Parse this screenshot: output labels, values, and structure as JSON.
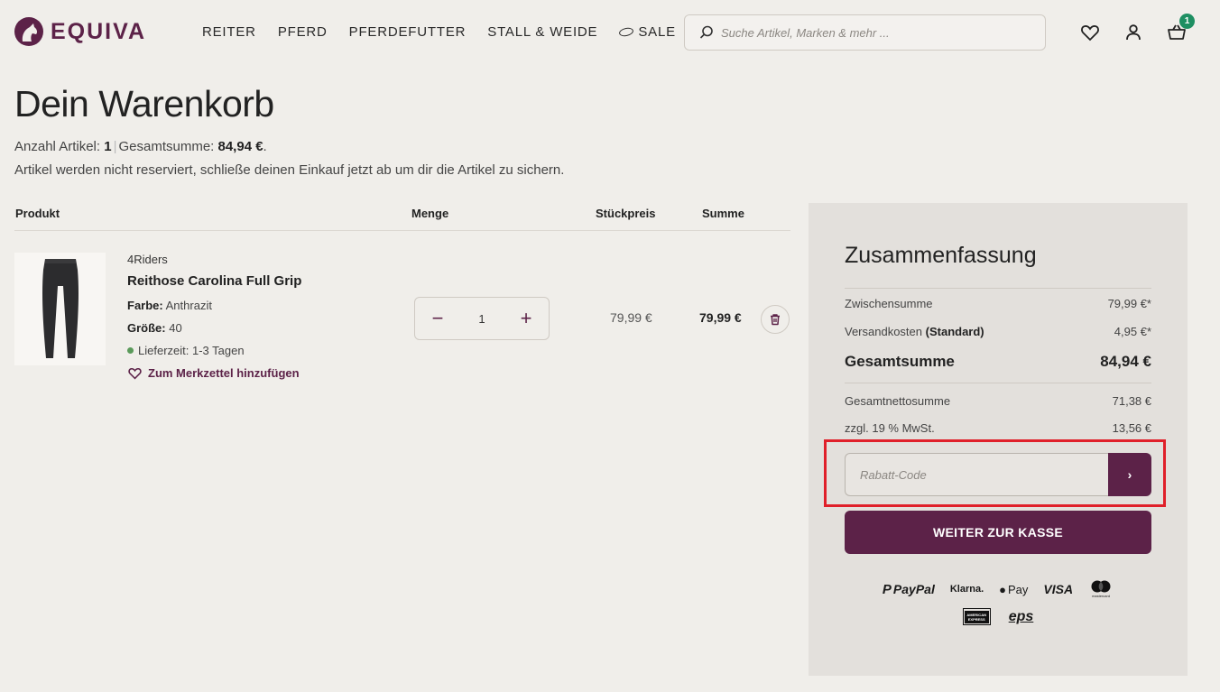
{
  "header": {
    "logo_text": "EQUIVA",
    "nav": [
      "REITER",
      "PFERD",
      "PFERDEFUTTER",
      "STALL & WEIDE",
      "SALE"
    ],
    "search_placeholder": "Suche Artikel, Marken & mehr ...",
    "cart_count": "1",
    "icons": [
      "heart-icon",
      "user-icon",
      "basket-icon",
      "search-icon"
    ]
  },
  "page": {
    "title": "Dein Warenkorb",
    "count_label": "Anzahl Artikel:",
    "count_value": "1",
    "total_label": "Gesamtsumme:",
    "total_value": "84,94 €",
    "notice": "Artikel werden nicht reserviert, schließe deinen Einkauf jetzt ab um dir die Artikel zu sichern."
  },
  "table": {
    "headers": {
      "product": "Produkt",
      "quantity": "Menge",
      "unit_price": "Stückpreis",
      "sum": "Summe"
    }
  },
  "item": {
    "brand": "4Riders",
    "name": "Reithose Carolina Full Grip",
    "color_label": "Farbe:",
    "color_value": "Anthrazit",
    "size_label": "Größe:",
    "size_value": "40",
    "delivery": "Lieferzeit: 1-3 Tagen",
    "wishlist": "Zum Merkzettel hinzufügen",
    "quantity": "1",
    "unit_price": "79,99 €",
    "line_total": "79,99 €"
  },
  "summary": {
    "title": "Zusammenfassung",
    "subtotal_label": "Zwischensumme",
    "subtotal_value": "79,99 €*",
    "shipping_label": "Versandkosten",
    "shipping_method": "(Standard)",
    "shipping_value": "4,95 €*",
    "total_label": "Gesamtsumme",
    "total_value": "84,94 €",
    "net_label": "Gesamtnettosumme",
    "net_value": "71,38 €",
    "vat_label": "zzgl. 19 % MwSt.",
    "vat_value": "13,56 €",
    "coupon_placeholder": "Rabatt-Code",
    "checkout_label": "WEITER ZUR KASSE",
    "payment_methods": {
      "paypal": "PayPal",
      "klarna": "Klarna.",
      "applepay": "Pay",
      "visa": "VISA",
      "mastercard": "mastercard",
      "amex": "AMERICAN EXPRESS",
      "eps": "eps"
    }
  },
  "colors": {
    "brand": "#5c2248",
    "background": "#f0eeea",
    "panel": "#e3e0dc",
    "badge": "#1e8f62",
    "highlight": "#e0202a"
  }
}
